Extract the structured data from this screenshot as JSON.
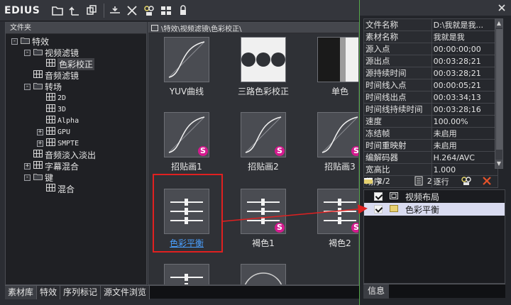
{
  "app": {
    "brand": "EDIUS"
  },
  "toolbar": {
    "icons": [
      "new-folder-icon",
      "up-folder-icon",
      "copy-icon",
      "import-icon",
      "delete-icon",
      "properties-icon",
      "view-mode-icon",
      "lock-icon"
    ]
  },
  "folder_panel": {
    "header": "文件夹",
    "tree": [
      {
        "label": "特效",
        "expander": "-",
        "level": 0
      },
      {
        "label": "视频滤镜",
        "expander": "-",
        "level": 1
      },
      {
        "label": "色彩校正",
        "expander": "",
        "level": 2,
        "selected": true
      },
      {
        "label": "音频滤镜",
        "expander": "",
        "level": 1
      },
      {
        "label": "转场",
        "expander": "-",
        "level": 1
      },
      {
        "label": "2D",
        "expander": "",
        "level": 2
      },
      {
        "label": "3D",
        "expander": "",
        "level": 2
      },
      {
        "label": "Alpha",
        "expander": "",
        "level": 2
      },
      {
        "label": "GPU",
        "expander": "+",
        "level": 2
      },
      {
        "label": "SMPTE",
        "expander": "+",
        "level": 2
      },
      {
        "label": "音频淡入淡出",
        "expander": "",
        "level": 1
      },
      {
        "label": "字幕混合",
        "expander": "+",
        "level": 1
      },
      {
        "label": "键",
        "expander": "-",
        "level": 1
      },
      {
        "label": "混合",
        "expander": "",
        "level": 2
      }
    ]
  },
  "bottom_tabs": [
    "素材库",
    "特效",
    "序列标记",
    "源文件浏览"
  ],
  "effects_panel": {
    "path": "\\特效\\视频滤镜\\色彩校正\\",
    "items": [
      {
        "label": "YUV曲线",
        "thumb": "curve",
        "badge": ""
      },
      {
        "label": "三路色彩校正",
        "thumb": "three-circles",
        "badge": ""
      },
      {
        "label": "单色",
        "thumb": "mono",
        "badge": ""
      },
      {
        "label": "招贴画1",
        "thumb": "curve",
        "badge": "S"
      },
      {
        "label": "招贴画2",
        "thumb": "curve",
        "badge": "S"
      },
      {
        "label": "招贴画3",
        "thumb": "curve",
        "badge": "S"
      },
      {
        "label": "色彩平衡",
        "thumb": "sliders",
        "badge": "",
        "selected": true
      },
      {
        "label": "褐色1",
        "thumb": "sliders",
        "badge": "S"
      },
      {
        "label": "褐色2",
        "thumb": "sliders",
        "badge": "S"
      },
      {
        "label": "",
        "thumb": "sliders",
        "badge": ""
      },
      {
        "label": "",
        "thumb": "circle",
        "badge": ""
      }
    ]
  },
  "info_panel": {
    "properties": [
      {
        "key": "文件名称",
        "value": "D:\\我就是我..."
      },
      {
        "key": "素材名称",
        "value": "我就是我"
      },
      {
        "key": "源入点",
        "value": "00:00:00;00"
      },
      {
        "key": "源出点",
        "value": "00:03:28;21"
      },
      {
        "key": "源持续时间",
        "value": "00:03:28;21"
      },
      {
        "key": "时间线入点",
        "value": "00:00:05;21"
      },
      {
        "key": "时间线出点",
        "value": "00:03:34;13"
      },
      {
        "key": "时间线持续时间",
        "value": "00:03:28;16"
      },
      {
        "key": "速度",
        "value": "100.00%"
      },
      {
        "key": "冻结帧",
        "value": "未启用"
      },
      {
        "key": "时间重映射",
        "value": "未启用"
      },
      {
        "key": "编解码器",
        "value": "H.264/AVC"
      },
      {
        "key": "宽高比",
        "value": "1.000"
      },
      {
        "key": "场序",
        "value": "逐行"
      }
    ],
    "layer_count": "2/2",
    "effect_count": "2",
    "layers": [
      {
        "label": "视频布局",
        "checked": true,
        "selected": false
      },
      {
        "label": "色彩平衡",
        "checked": true,
        "selected": true
      }
    ],
    "tab": "信息"
  },
  "colors": {
    "annotation": "#e02020",
    "selected_text": "#4aa0ff",
    "badge": "#d51a8f",
    "panel_border": "#56a84a"
  }
}
